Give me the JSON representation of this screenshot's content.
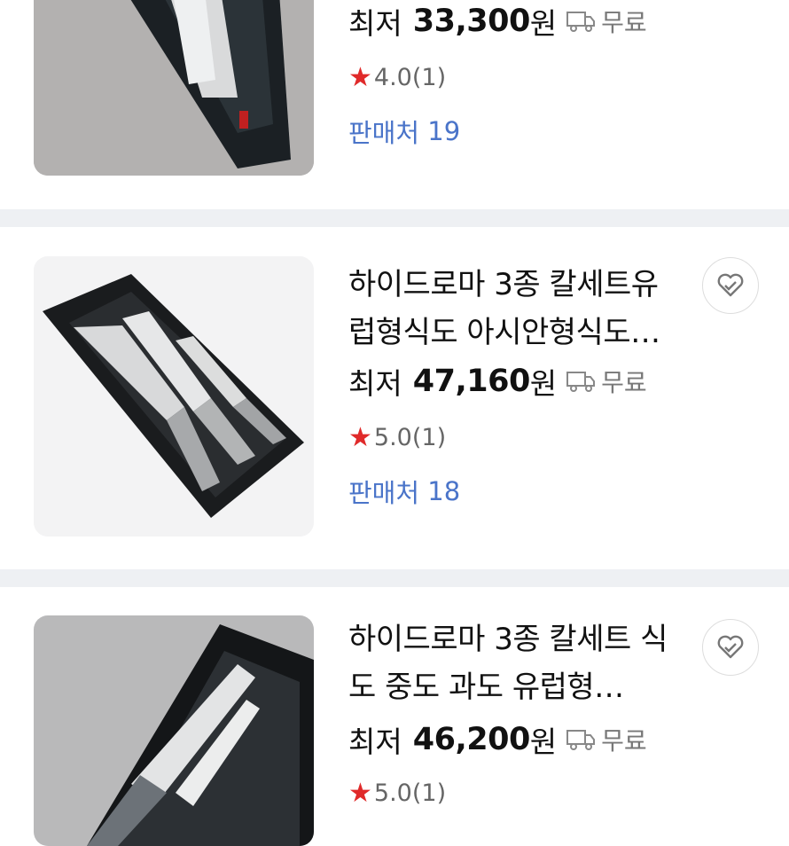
{
  "products": [
    {
      "title": "",
      "price_label": "최저",
      "price": "33,300",
      "currency": "원",
      "shipping": "무료",
      "rating": "4.0",
      "review_count": "(1)",
      "sellers_label": "판매처",
      "sellers_count": "19"
    },
    {
      "title": "하이드로마 3종 칼세트유럽형식도 아시안형식도…",
      "price_label": "최저",
      "price": "47,160",
      "currency": "원",
      "shipping": "무료",
      "rating": "5.0",
      "review_count": "(1)",
      "sellers_label": "판매처",
      "sellers_count": "18"
    },
    {
      "title": "하이드로마 3종 칼세트 식도 중도 과도 유럽형…",
      "price_label": "최저",
      "price": "46,200",
      "currency": "원",
      "shipping": "무료",
      "rating": "5.0",
      "review_count": "(1)"
    }
  ],
  "icons": {
    "star": "★",
    "truck": "truck-icon",
    "favorite": "heart-check-icon"
  },
  "colors": {
    "star": "#e02a2a",
    "sellers_link": "#4a74c9",
    "separator": "#eef0f3"
  }
}
